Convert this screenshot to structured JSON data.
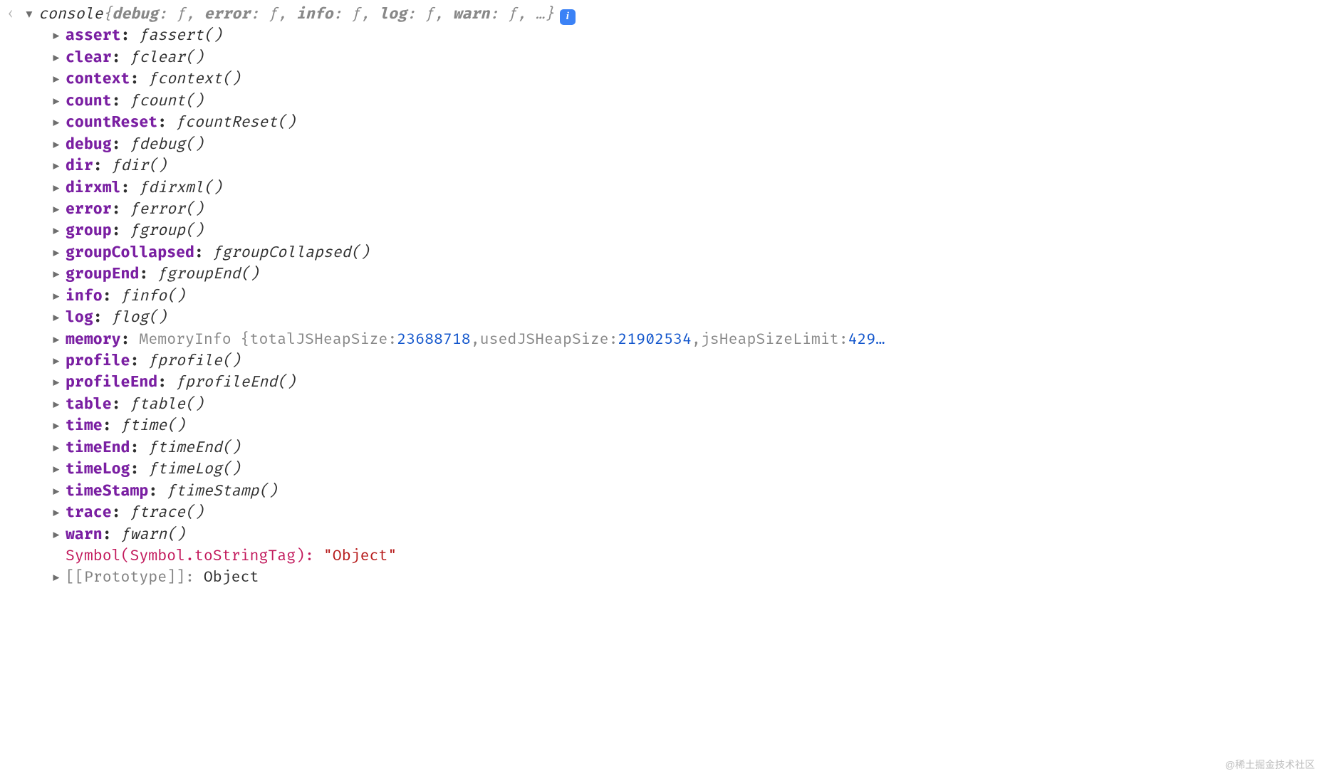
{
  "header": {
    "object_name": "console",
    "summary_raw": " {debug: ƒ, error: ƒ, info: ƒ, log: ƒ, warn: ƒ, …}",
    "info_badge": "i"
  },
  "funcs": [
    {
      "name": "assert",
      "sig": "assert()"
    },
    {
      "name": "clear",
      "sig": "clear()"
    },
    {
      "name": "context",
      "sig": "context()"
    },
    {
      "name": "count",
      "sig": "count()"
    },
    {
      "name": "countReset",
      "sig": "countReset()"
    },
    {
      "name": "debug",
      "sig": "debug()"
    },
    {
      "name": "dir",
      "sig": "dir()"
    },
    {
      "name": "dirxml",
      "sig": "dirxml()"
    },
    {
      "name": "error",
      "sig": "error()"
    },
    {
      "name": "group",
      "sig": "group()"
    },
    {
      "name": "groupCollapsed",
      "sig": "groupCollapsed()"
    },
    {
      "name": "groupEnd",
      "sig": "groupEnd()"
    },
    {
      "name": "info",
      "sig": "info()"
    },
    {
      "name": "log",
      "sig": "log()"
    }
  ],
  "memory": {
    "key": "memory",
    "class": "MemoryInfo",
    "k1": "totalJSHeapSize",
    "v1": "23688718",
    "k2": "usedJSHeapSize",
    "v2": "21902534",
    "k3": "jsHeapSizeLimit",
    "v3": "429…"
  },
  "funcs2": [
    {
      "name": "profile",
      "sig": "profile()"
    },
    {
      "name": "profileEnd",
      "sig": "profileEnd()"
    },
    {
      "name": "table",
      "sig": "table()"
    },
    {
      "name": "time",
      "sig": "time()"
    },
    {
      "name": "timeEnd",
      "sig": "timeEnd()"
    },
    {
      "name": "timeLog",
      "sig": "timeLog()"
    },
    {
      "name": "timeStamp",
      "sig": "timeStamp()"
    },
    {
      "name": "trace",
      "sig": "trace()"
    },
    {
      "name": "warn",
      "sig": "warn()"
    }
  ],
  "symbol_row": {
    "key": "Symbol(Symbol.toStringTag)",
    "value": "\"Object\""
  },
  "proto_row": {
    "key": "[[Prototype]]",
    "value": "Object"
  },
  "watermark": "@稀土掘金技术社区"
}
